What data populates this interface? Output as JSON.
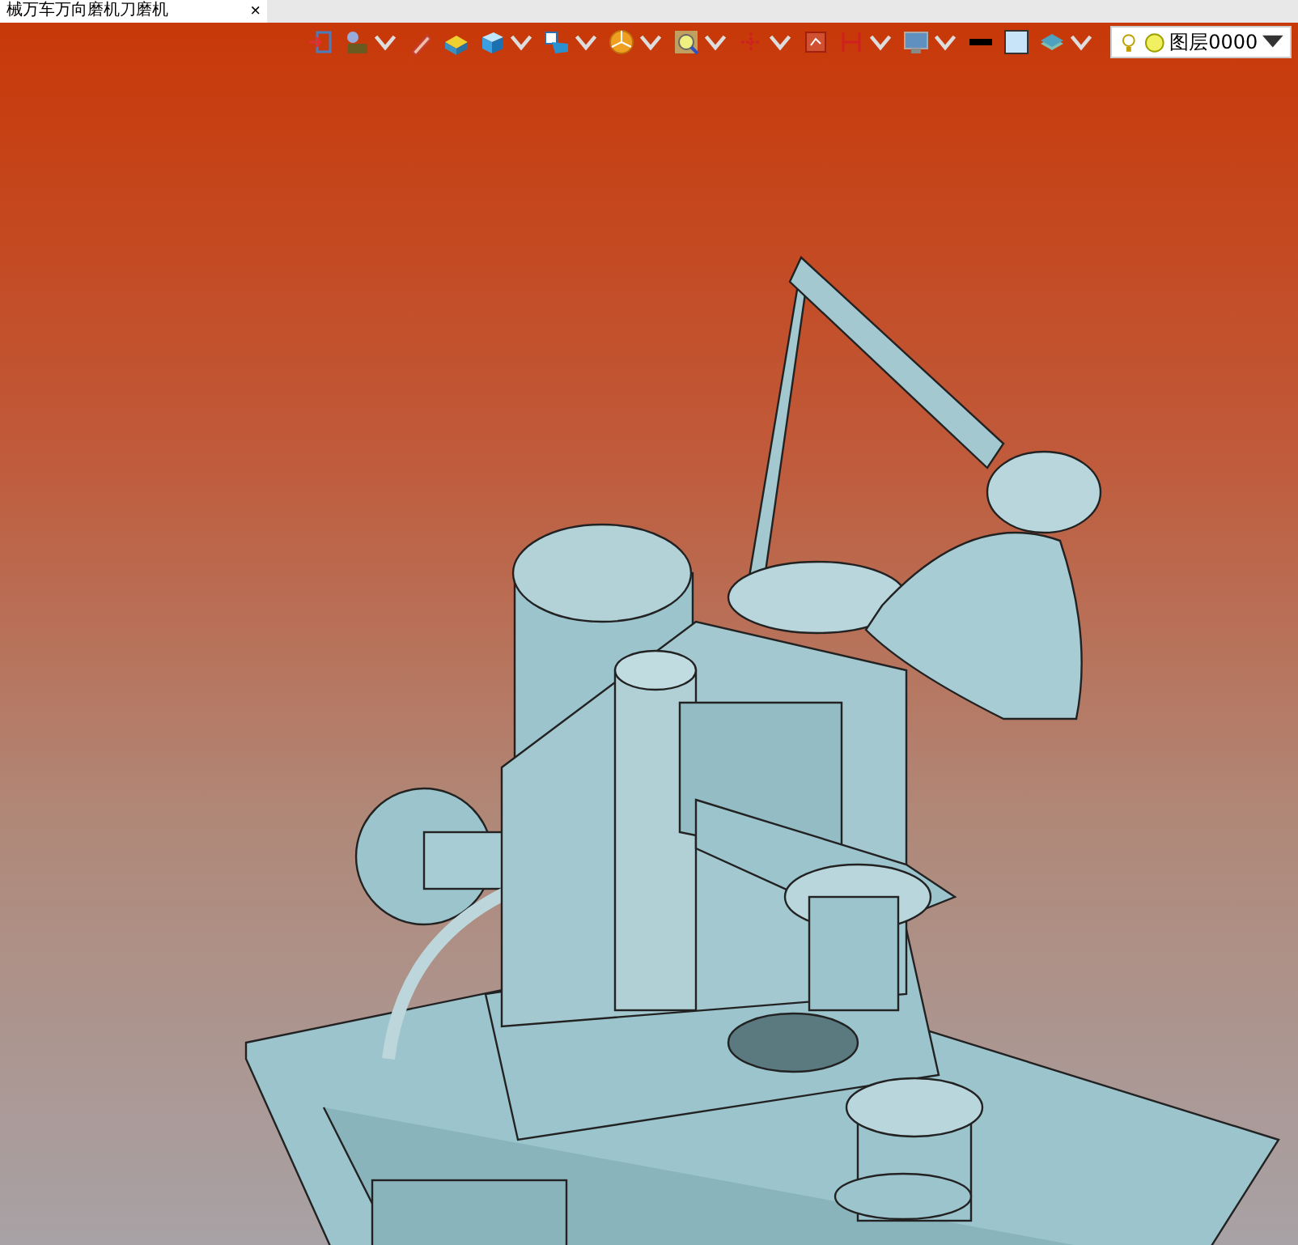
{
  "document_tab": {
    "title": "械万车万向磨机刀磨机",
    "close": "×"
  },
  "toolbar": [
    {
      "kind": "exit",
      "dropdown": false
    },
    {
      "kind": "sketch",
      "dropdown": true
    },
    {
      "kind": "pen",
      "dropdown": false
    },
    {
      "kind": "box",
      "dropdown": false
    },
    {
      "kind": "cube",
      "dropdown": true
    },
    {
      "kind": "cube-label",
      "dropdown": true
    },
    {
      "kind": "pie",
      "dropdown": true
    },
    {
      "kind": "zoom",
      "dropdown": true
    },
    {
      "kind": "crosshair",
      "dropdown": true
    },
    {
      "kind": "frame",
      "dropdown": false
    },
    {
      "kind": "dimension",
      "dropdown": true
    },
    {
      "kind": "monitor",
      "dropdown": true
    },
    {
      "kind": "line-color",
      "dropdown": false
    },
    {
      "kind": "fill-color",
      "dropdown": false
    },
    {
      "kind": "layers",
      "dropdown": true
    }
  ],
  "layer_selector": {
    "value": "图层0000"
  }
}
